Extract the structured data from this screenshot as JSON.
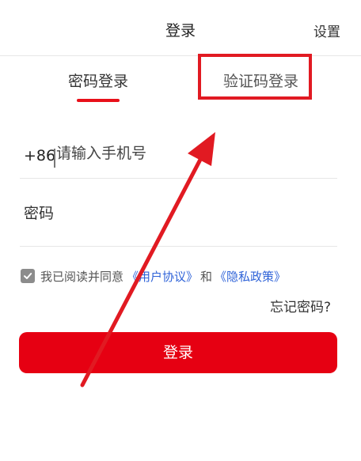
{
  "header": {
    "title": "登录",
    "settings_label": "设置"
  },
  "tabs": [
    {
      "label": "密码登录",
      "active": true
    },
    {
      "label": "验证码登录",
      "active": false
    }
  ],
  "phone": {
    "prefix": "+86",
    "placeholder": "请输入手机号"
  },
  "password": {
    "placeholder": "密码"
  },
  "agreement": {
    "checked": true,
    "text": "我已阅读并同意",
    "user_agreement": "《用户协议》",
    "and": "和",
    "privacy_policy": "《隐私政策》"
  },
  "forgot_password": "忘记密码?",
  "login_button": "登录",
  "colors": {
    "accent": "#e60012",
    "annotation": "#e11a22",
    "link": "#2f63d8"
  }
}
